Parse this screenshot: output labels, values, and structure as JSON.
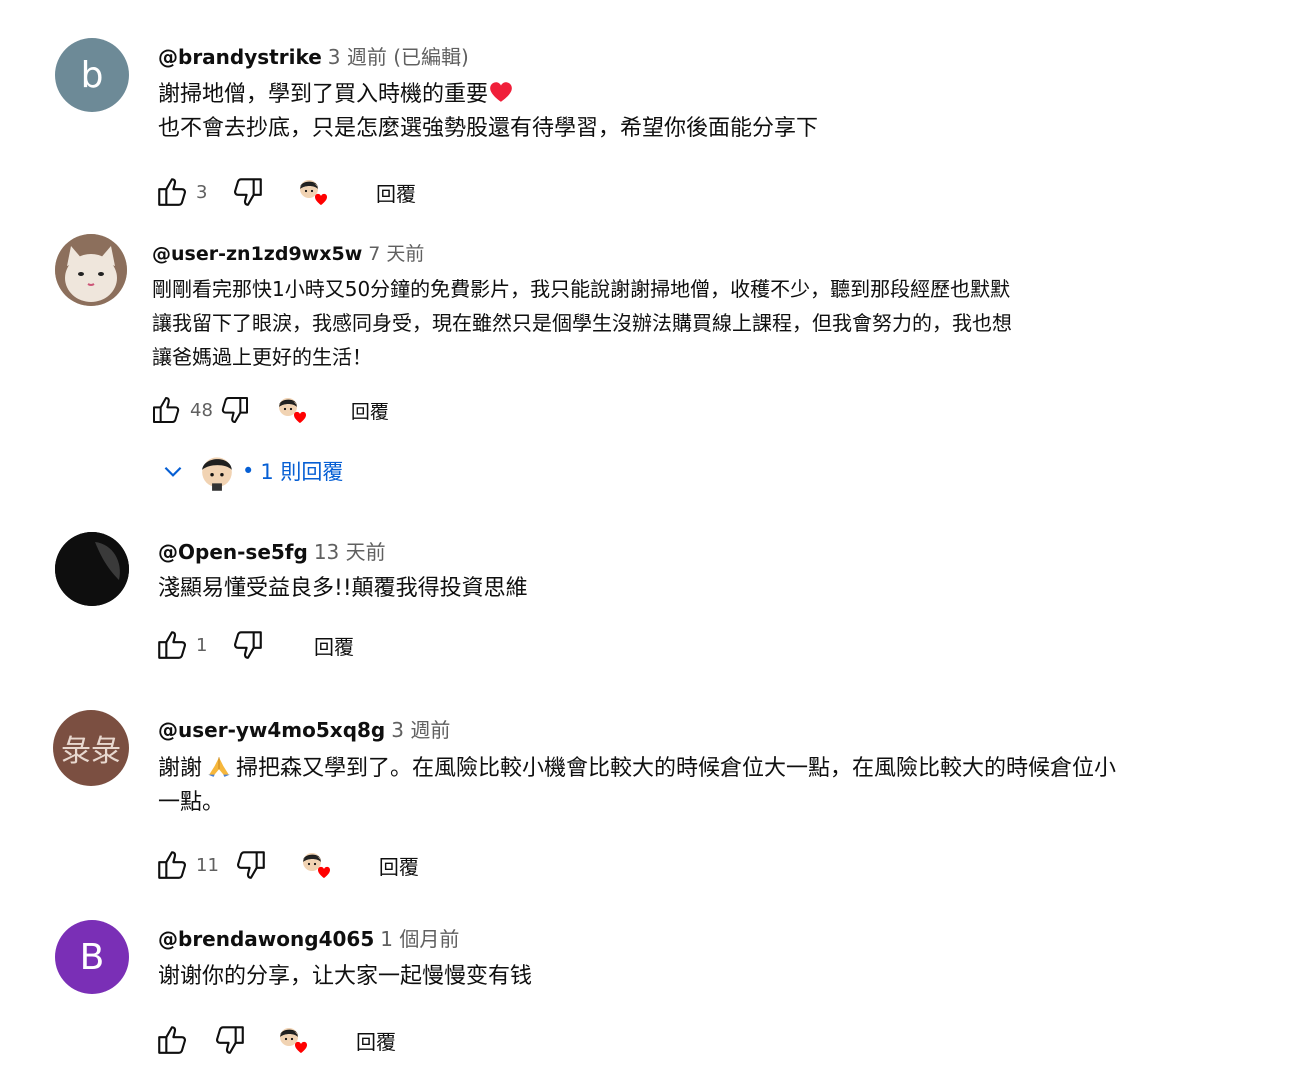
{
  "comments": [
    {
      "avatar_text": "b",
      "handle": "@brandystrike",
      "time": "3 週前 (已編輯)",
      "lines_pre": "謝掃地僧，學到了買入時機的重要",
      "line2": "也不會去抄底，只是怎麼選強勢股還有待學習，希望你後面能分享下",
      "likes": "3",
      "reply_label": "回覆"
    },
    {
      "avatar_text": "",
      "handle": "@user-zn1zd9wx5w",
      "time": "7 天前",
      "line1": "剛剛看完那快1小時又50分鐘的免費影片，我只能說謝謝掃地僧，收穫不少，聽到那段經歷也默默",
      "line2": "讓我留下了眼淚，我感同身受，現在雖然只是個學生沒辦法購買線上課程，但我會努力的，我也想",
      "line3": "讓爸媽過上更好的生活！",
      "likes": "48",
      "reply_label": "回覆",
      "replies_toggle": "1 則回覆"
    },
    {
      "avatar_text": "",
      "handle": "@Open-se5fg",
      "time": "13 天前",
      "line1": "淺顯易懂受益良多!!顛覆我得投資思維",
      "likes": "1",
      "reply_label": "回覆"
    },
    {
      "avatar_text": "彔彔",
      "handle": "@user-yw4mo5xq8g",
      "time": "3 週前",
      "line1_pre": "謝謝",
      "line1_post": "掃把森又學到了。在風險比較小機會比較大的時候倉位大一點，在風險比較大的時候倉位小",
      "line2": "一點。",
      "likes": "11",
      "reply_label": "回覆"
    },
    {
      "avatar_text": "B",
      "handle": "@brendawong4065",
      "time": "1 個月前",
      "line1": "谢谢你的分享，让大家一起慢慢变有钱",
      "reply_label": "回覆"
    }
  ],
  "icons": {
    "like": "thumbs-up-icon",
    "dislike": "thumbs-down-icon",
    "creator_heart": "creator-heart-icon",
    "red_heart": "red-heart-emoji",
    "pray": "folded-hands-emoji",
    "chevron": "chevron-down-icon"
  },
  "colors": {
    "link": "#065fd4",
    "heart": "#ff0000",
    "meta": "#606060"
  }
}
